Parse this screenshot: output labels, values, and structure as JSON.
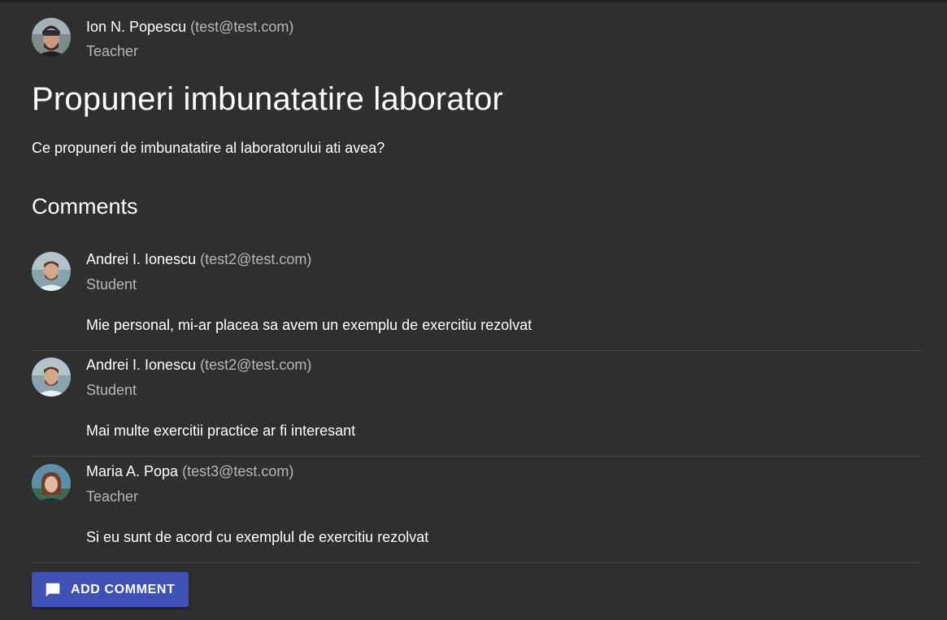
{
  "post": {
    "author": {
      "name": "Ion N. Popescu",
      "email": "(test@test.com)",
      "role": "Teacher",
      "avatar_icon": "avatar-man-beanie"
    },
    "title": "Propuneri imbunatatire laborator",
    "description": "Ce propuneri de imbunatatire al laboratorului ati avea?"
  },
  "comments_heading": "Comments",
  "comments": [
    {
      "name": "Andrei I. Ionescu",
      "email": "(test2@test.com)",
      "role": "Student",
      "text": "Mie personal, mi-ar placea sa avem un exemplu de exercitiu rezolvat",
      "avatar_icon": "avatar-man-beard"
    },
    {
      "name": "Andrei I. Ionescu",
      "email": "(test2@test.com)",
      "role": "Student",
      "text": "Mai multe exercitii practice ar fi interesant",
      "avatar_icon": "avatar-man-beard"
    },
    {
      "name": "Maria A. Popa",
      "email": "(test3@test.com)",
      "role": "Teacher",
      "text": "Si eu sunt de acord cu exemplul de exercitiu rezolvat",
      "avatar_icon": "avatar-woman"
    }
  ],
  "add_comment": {
    "label": "ADD COMMENT",
    "icon": "comment-icon"
  },
  "colors": {
    "background": "#2f2f2f",
    "accent": "#3f51b5",
    "muted_text": "#b7b7b7",
    "divider": "#4a4a4a"
  }
}
